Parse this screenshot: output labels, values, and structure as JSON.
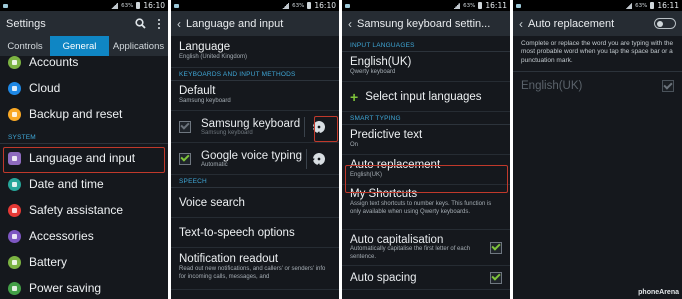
{
  "status": {
    "battery_pct": "63%",
    "time": "16:10",
    "time2": "16:11"
  },
  "p1": {
    "title": "Settings",
    "tabs": [
      "Controls",
      "General",
      "Applications"
    ],
    "items_top": [
      {
        "label": "Accounts",
        "icon": "accounts-icon",
        "color": "#7cb342"
      },
      {
        "label": "Cloud",
        "icon": "cloud-icon",
        "color": "#1e88e5"
      },
      {
        "label": "Backup and reset",
        "icon": "backup-icon",
        "color": "#f9a825"
      }
    ],
    "section_system": "SYSTEM",
    "items_bottom": [
      {
        "label": "Language and input",
        "icon": "language-icon",
        "color": "#8e6bbf"
      },
      {
        "label": "Date and time",
        "icon": "date-time-icon",
        "color": "#26a69a"
      },
      {
        "label": "Safety assistance",
        "icon": "safety-icon",
        "color": "#e53935"
      },
      {
        "label": "Accessories",
        "icon": "accessories-icon",
        "color": "#7e57c2"
      },
      {
        "label": "Battery",
        "icon": "battery-icon",
        "color": "#7cb342"
      },
      {
        "label": "Power saving",
        "icon": "power-saving-icon",
        "color": "#43a047"
      }
    ]
  },
  "p2": {
    "title": "Language and input",
    "language": {
      "label": "Language",
      "value": "English (United Kingdom)"
    },
    "section_keyboards": "KEYBOARDS AND INPUT METHODS",
    "default": {
      "label": "Default",
      "value": "Samsung keyboard"
    },
    "samsung_keyboard": {
      "label": "Samsung keyboard",
      "value": "Samsung keyboard"
    },
    "google_voice": {
      "label": "Google voice typing",
      "value": "Automatic"
    },
    "section_speech": "SPEECH",
    "voice_search": "Voice search",
    "tts": "Text-to-speech options",
    "notification": {
      "label": "Notification readout",
      "value": "Read out new notifications, and callers' or senders' info for incoming calls, messages, and"
    }
  },
  "p3": {
    "title": "Samsung keyboard settin...",
    "section_input_languages": "INPUT LANGUAGES",
    "english": {
      "label": "English(UK)",
      "value": "Qwerty keyboard"
    },
    "select_languages": "Select input languages",
    "section_smart": "SMART TYPING",
    "predictive": {
      "label": "Predictive text",
      "value": "On"
    },
    "auto_replacement": {
      "label": "Auto replacement",
      "value": "English(UK)"
    },
    "shortcuts": {
      "label": "My Shortcuts",
      "value": "Assign text shortcuts to number keys. This function is only available when using Qwerty keyboards."
    },
    "auto_cap": {
      "label": "Auto capitalisation",
      "value": "Automatically capitalise the first letter of each sentence."
    },
    "auto_spacing": {
      "label": "Auto spacing"
    }
  },
  "p4": {
    "title": "Auto replacement",
    "description": "Complete or replace the word you are typing with the most probable word when you tap the space bar or a punctuation mark.",
    "english": "English(UK)"
  },
  "watermark": "phoneArena"
}
